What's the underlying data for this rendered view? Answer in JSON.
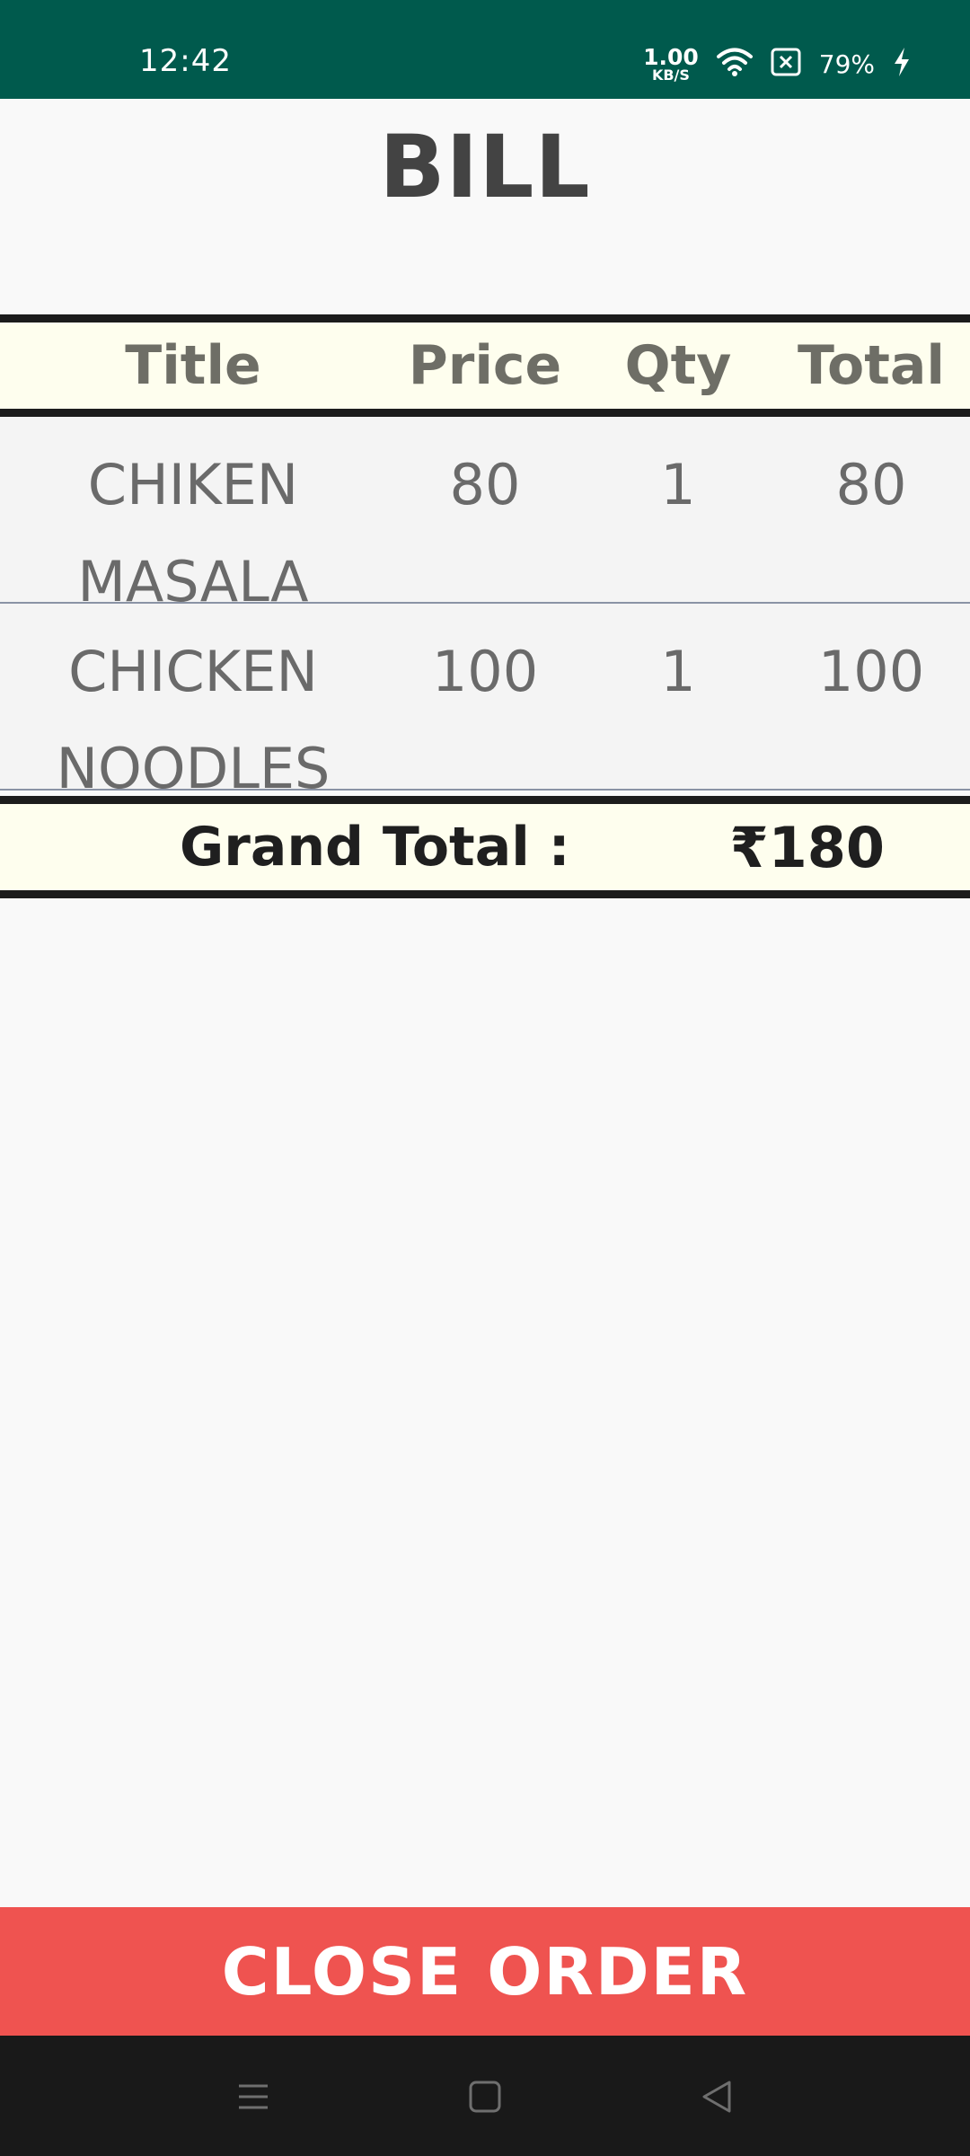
{
  "status_bar": {
    "time": "12:42",
    "net_speed_value": "1.00",
    "net_speed_unit": "KB/S",
    "battery": "79%",
    "icons": [
      "wifi-icon",
      "no-sim-icon",
      "charging-icon"
    ]
  },
  "page": {
    "title": "BILL"
  },
  "table": {
    "headers": {
      "title": "Title",
      "price": "Price",
      "qty": "Qty",
      "total": "Total"
    },
    "rows": [
      {
        "title": "CHIKEN MASALA",
        "price": "80",
        "qty": "1",
        "total": "80"
      },
      {
        "title": "CHICKEN NOODLES",
        "price": "100",
        "qty": "1",
        "total": "100"
      }
    ],
    "grand_total_label": "Grand Total :",
    "grand_total_value": "₹180"
  },
  "actions": {
    "close_order": "CLOSE ORDER"
  },
  "nav_bar": {
    "buttons": [
      "menu-icon",
      "home-icon",
      "back-icon"
    ]
  },
  "colors": {
    "status_bar": "#005a4d",
    "header_bg": "#fefeee",
    "close_button": "#ef5350",
    "nav_bar": "#191919"
  }
}
